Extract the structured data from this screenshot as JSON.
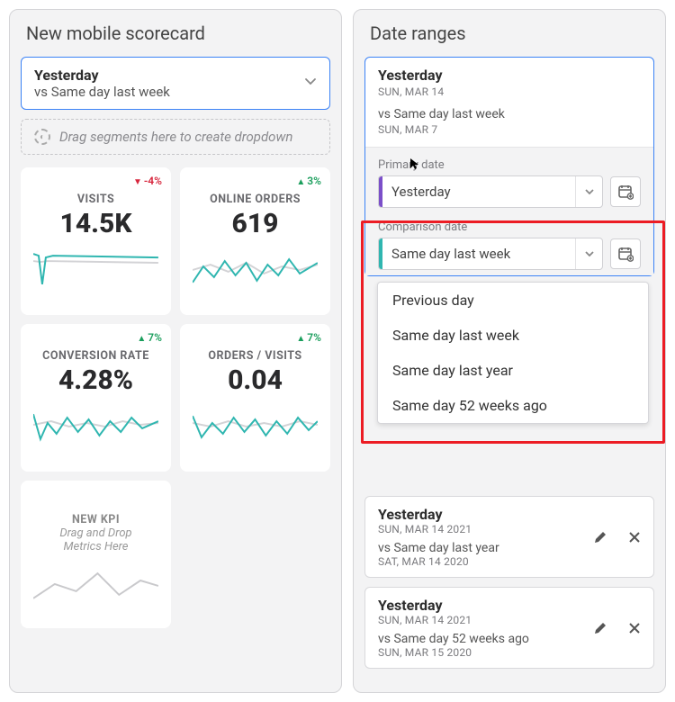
{
  "colors": {
    "accent_blue": "#3b82f6",
    "teal": "#2fb6b0",
    "purple": "#7b4fc9",
    "up_green": "#1a9e5c",
    "down_red": "#d7263d",
    "highlight_red": "#ec1c24"
  },
  "left_panel": {
    "title": "New mobile scorecard",
    "range_select": {
      "primary": "Yesterday",
      "sub": "vs Same day last week"
    },
    "drop_zone": "Drag segments here to create dropdown",
    "tiles": [
      {
        "label": "VISITS",
        "value": "14.5K",
        "delta": "-4%",
        "direction": "down"
      },
      {
        "label": "ONLINE ORDERS",
        "value": "619",
        "delta": "3%",
        "direction": "up"
      },
      {
        "label": "CONVERSION RATE",
        "value": "4.28%",
        "delta": "7%",
        "direction": "up"
      },
      {
        "label": "ORDERS / VISITS",
        "value": "0.04",
        "delta": "7%",
        "direction": "up"
      }
    ],
    "placeholder_tile": {
      "label": "NEW KPI",
      "sub1": "Drag and Drop",
      "sub2": "Metrics Here"
    }
  },
  "right_panel": {
    "title": "Date ranges",
    "active_card": {
      "primary": "Yesterday",
      "primary_sub": "SUN, MAR 14",
      "vs": "vs Same day last week",
      "vs_sub": "SUN, MAR 7"
    },
    "primary_date": {
      "label": "Primary date",
      "value": "Yesterday"
    },
    "comparison_date": {
      "label": "Comparison date",
      "value": "Same day last week",
      "options": [
        "Previous day",
        "Same day last week",
        "Same day last year",
        "Same day 52 weeks ago"
      ]
    },
    "range_cards": [
      {
        "title": "Yesterday",
        "title_sub": "SUN, MAR 14 2021",
        "vs": "vs Same day last year",
        "vs_sub": "SAT, MAR 14 2020"
      },
      {
        "title": "Yesterday",
        "title_sub": "SUN, MAR 14 2021",
        "vs": "vs Same day 52 weeks ago",
        "vs_sub": "SUN, MAR 15 2020"
      }
    ]
  }
}
